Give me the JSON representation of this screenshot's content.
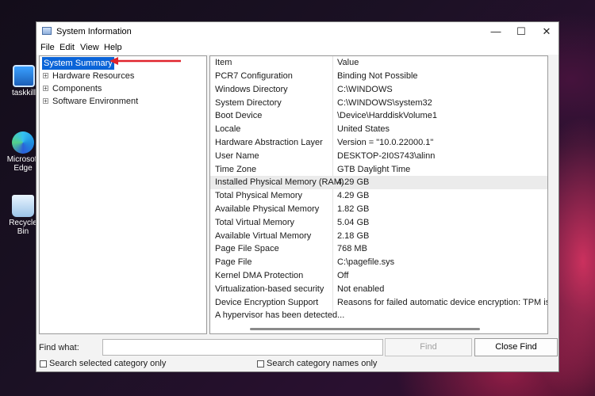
{
  "desktop": {
    "icons": [
      {
        "label": "taskkill"
      },
      {
        "label": "Microsoft Edge"
      },
      {
        "label": "Recycle Bin"
      }
    ]
  },
  "window": {
    "title": "System Information",
    "controls": {
      "minimize": "—",
      "maximize": "☐",
      "close": "✕"
    }
  },
  "menu": [
    "File",
    "Edit",
    "View",
    "Help"
  ],
  "tree": {
    "selected": "System Summary",
    "children": [
      "Hardware Resources",
      "Components",
      "Software Environment"
    ],
    "expander_glyph": "+"
  },
  "table": {
    "columns": [
      "Item",
      "Value"
    ],
    "rows": [
      {
        "item": "PCR7 Configuration",
        "value": "Binding Not Possible"
      },
      {
        "item": "Windows Directory",
        "value": "C:\\WINDOWS"
      },
      {
        "item": "System Directory",
        "value": "C:\\WINDOWS\\system32"
      },
      {
        "item": "Boot Device",
        "value": "\\Device\\HarddiskVolume1"
      },
      {
        "item": "Locale",
        "value": "United States"
      },
      {
        "item": "Hardware Abstraction Layer",
        "value": "Version = \"10.0.22000.1\""
      },
      {
        "item": "User Name",
        "value": "DESKTOP-2I0S743\\alinn"
      },
      {
        "item": "Time Zone",
        "value": "GTB Daylight Time"
      },
      {
        "item": "Installed Physical Memory (RAM)",
        "value": "4.29 GB"
      },
      {
        "item": "Total Physical Memory",
        "value": "4.29 GB"
      },
      {
        "item": "Available Physical Memory",
        "value": "1.82 GB"
      },
      {
        "item": "Total Virtual Memory",
        "value": "5.04 GB"
      },
      {
        "item": "Available Virtual Memory",
        "value": "2.18 GB"
      },
      {
        "item": "Page File Space",
        "value": "768 MB"
      },
      {
        "item": "Page File",
        "value": "C:\\pagefile.sys"
      },
      {
        "item": "Kernel DMA Protection",
        "value": "Off"
      },
      {
        "item": "Virtualization-based security",
        "value": "Not enabled"
      },
      {
        "item": "Device Encryption Support",
        "value": "Reasons for failed automatic device encryption: TPM is not"
      },
      {
        "item": "A hypervisor has been detected...",
        "value": ""
      }
    ],
    "highlighted_row": "Installed Physical Memory (RAM)"
  },
  "find": {
    "label": "Find what:",
    "input_value": "",
    "find_button": "Find",
    "close_find_button": "Close Find",
    "option_selected_category": "Search selected category only",
    "option_category_names": "Search category names only"
  },
  "accent": {
    "selection": "#0a64d8",
    "annotation_arrow": "#e0242c"
  }
}
